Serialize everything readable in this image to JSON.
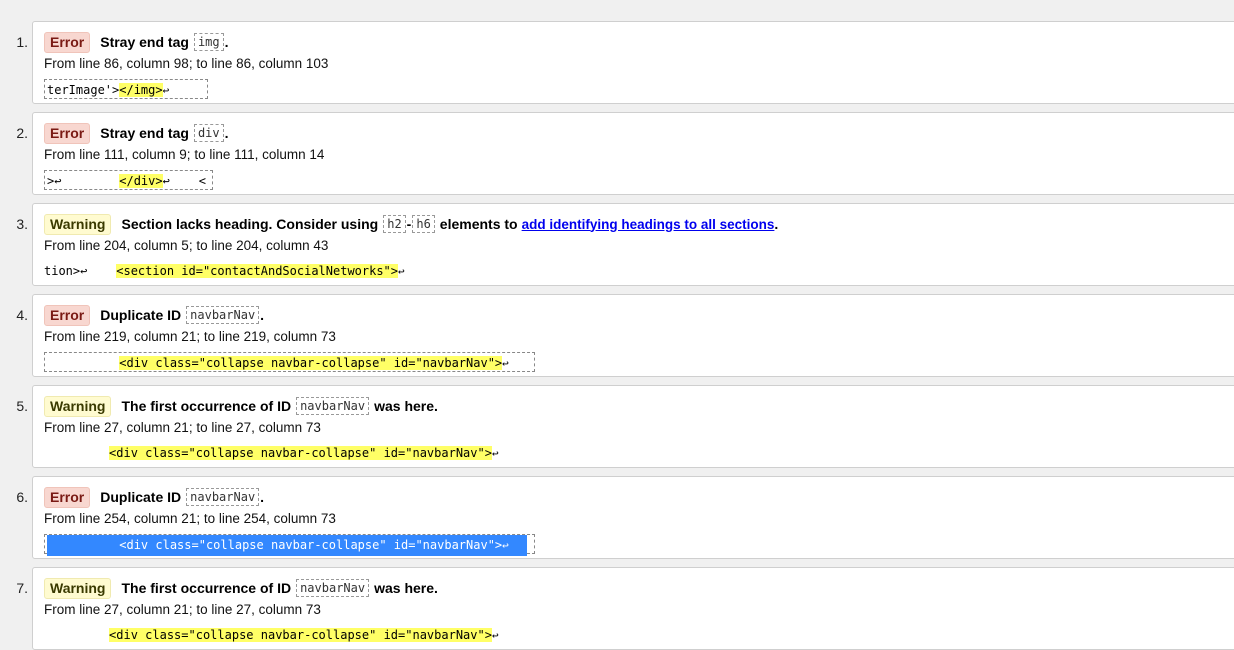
{
  "messages": [
    {
      "number": "1.",
      "type_label": "Error",
      "text_before": "Stray end tag",
      "code": "img",
      "text_after": ".",
      "location": "From line 86, column 98; to line 86, column 103",
      "extract_pre": "terImage'>",
      "extract_mark": "</img>",
      "extract_post": "↩"
    },
    {
      "number": "2.",
      "type_label": "Error",
      "text_before": "Stray end tag",
      "code": "div",
      "text_after": ".",
      "location": "From line 111, column 9; to line 111, column 14",
      "extract_pre": ">↩        ",
      "extract_mark": "</div>",
      "extract_post": "↩    <"
    },
    {
      "number": "3.",
      "type_label": "Warning",
      "text_before": "Section lacks heading. Consider using",
      "code": "h2",
      "code_sep": "-",
      "code2": "h6",
      "text_middle": "elements to",
      "link_text": "add identifying headings to all sections",
      "text_after": ".",
      "location": "From line 204, column 5; to line 204, column 43",
      "extract_pre": "tion>↩    ",
      "extract_mark": "<section id=\"contactAndSocialNetworks\">",
      "extract_post": "↩"
    },
    {
      "number": "4.",
      "type_label": "Error",
      "text_before": "Duplicate ID",
      "code": "navbarNav",
      "text_after": ".",
      "location": "From line 219, column 21; to line 219, column 73",
      "extract_pre": "          ",
      "extract_mark": "<div class=\"collapse navbar-collapse\" id=\"navbarNav\">",
      "extract_post": "↩"
    },
    {
      "number": "5.",
      "type_label": "Warning",
      "text_before": "The first occurrence of ID",
      "code": "navbarNav",
      "text_after": "was here.",
      "location": "From line 27, column 21; to line 27, column 73",
      "extract_pre": "         ",
      "extract_mark": "<div class=\"collapse navbar-collapse\" id=\"navbarNav\">",
      "extract_post": "↩"
    },
    {
      "number": "6.",
      "type_label": "Error",
      "text_before": "Duplicate ID",
      "code": "navbarNav",
      "text_after": ".",
      "location": "From line 254, column 21; to line 254, column 73",
      "extract_pre": "          ",
      "extract_mark": "<div class=\"collapse navbar-collapse\" id=\"navbarNav\">",
      "extract_post": "↩"
    },
    {
      "number": "7.",
      "type_label": "Warning",
      "text_before": "The first occurrence of ID",
      "code": "navbarNav",
      "text_after": "was here.",
      "location": "From line 27, column 21; to line 27, column 73",
      "extract_pre": "         ",
      "extract_mark": "<div class=\"collapse navbar-collapse\" id=\"navbarNav\">",
      "extract_post": "↩"
    }
  ],
  "colors": {
    "error_badge_bg": "#f8d7d0",
    "warning_badge_bg": "#fffbd0",
    "highlight": "#ffff66",
    "selection": "#3388ff",
    "link": "#0000ee"
  }
}
